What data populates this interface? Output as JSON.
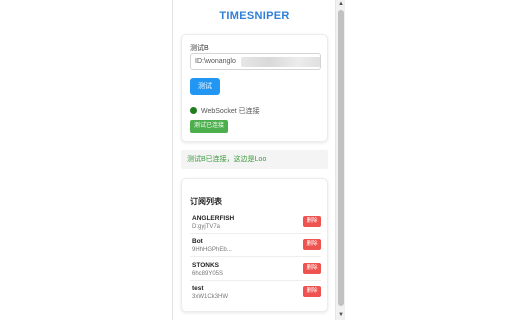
{
  "app": {
    "title": "TIMESNIPER"
  },
  "connection": {
    "label": "测试B",
    "url_value": "ID:\\wonanglo",
    "connect_button": "测试",
    "status_text": "WebSocket 已连接",
    "status_color": "#1e7e1e",
    "action_button": "测试已连接"
  },
  "message": {
    "text": "测试B已连接，这边是Loo"
  },
  "subscriptions": {
    "title": "订阅列表",
    "items": [
      {
        "name": "ANGLERFISH",
        "meta": "D:gyjTV7a",
        "delete_label": "删除"
      },
      {
        "name": "Bot",
        "meta": "9HhHGPhEb...",
        "delete_label": "删除"
      },
      {
        "name": "STONKS",
        "meta": "6hc89Y05S",
        "delete_label": "删除"
      },
      {
        "name": "test",
        "meta": "3xW1Ck3HW",
        "delete_label": "删除"
      }
    ]
  },
  "colors": {
    "accent": "#2f7fd9",
    "primary": "#2196f3",
    "success": "#4cae4c",
    "danger": "#ef5350"
  }
}
